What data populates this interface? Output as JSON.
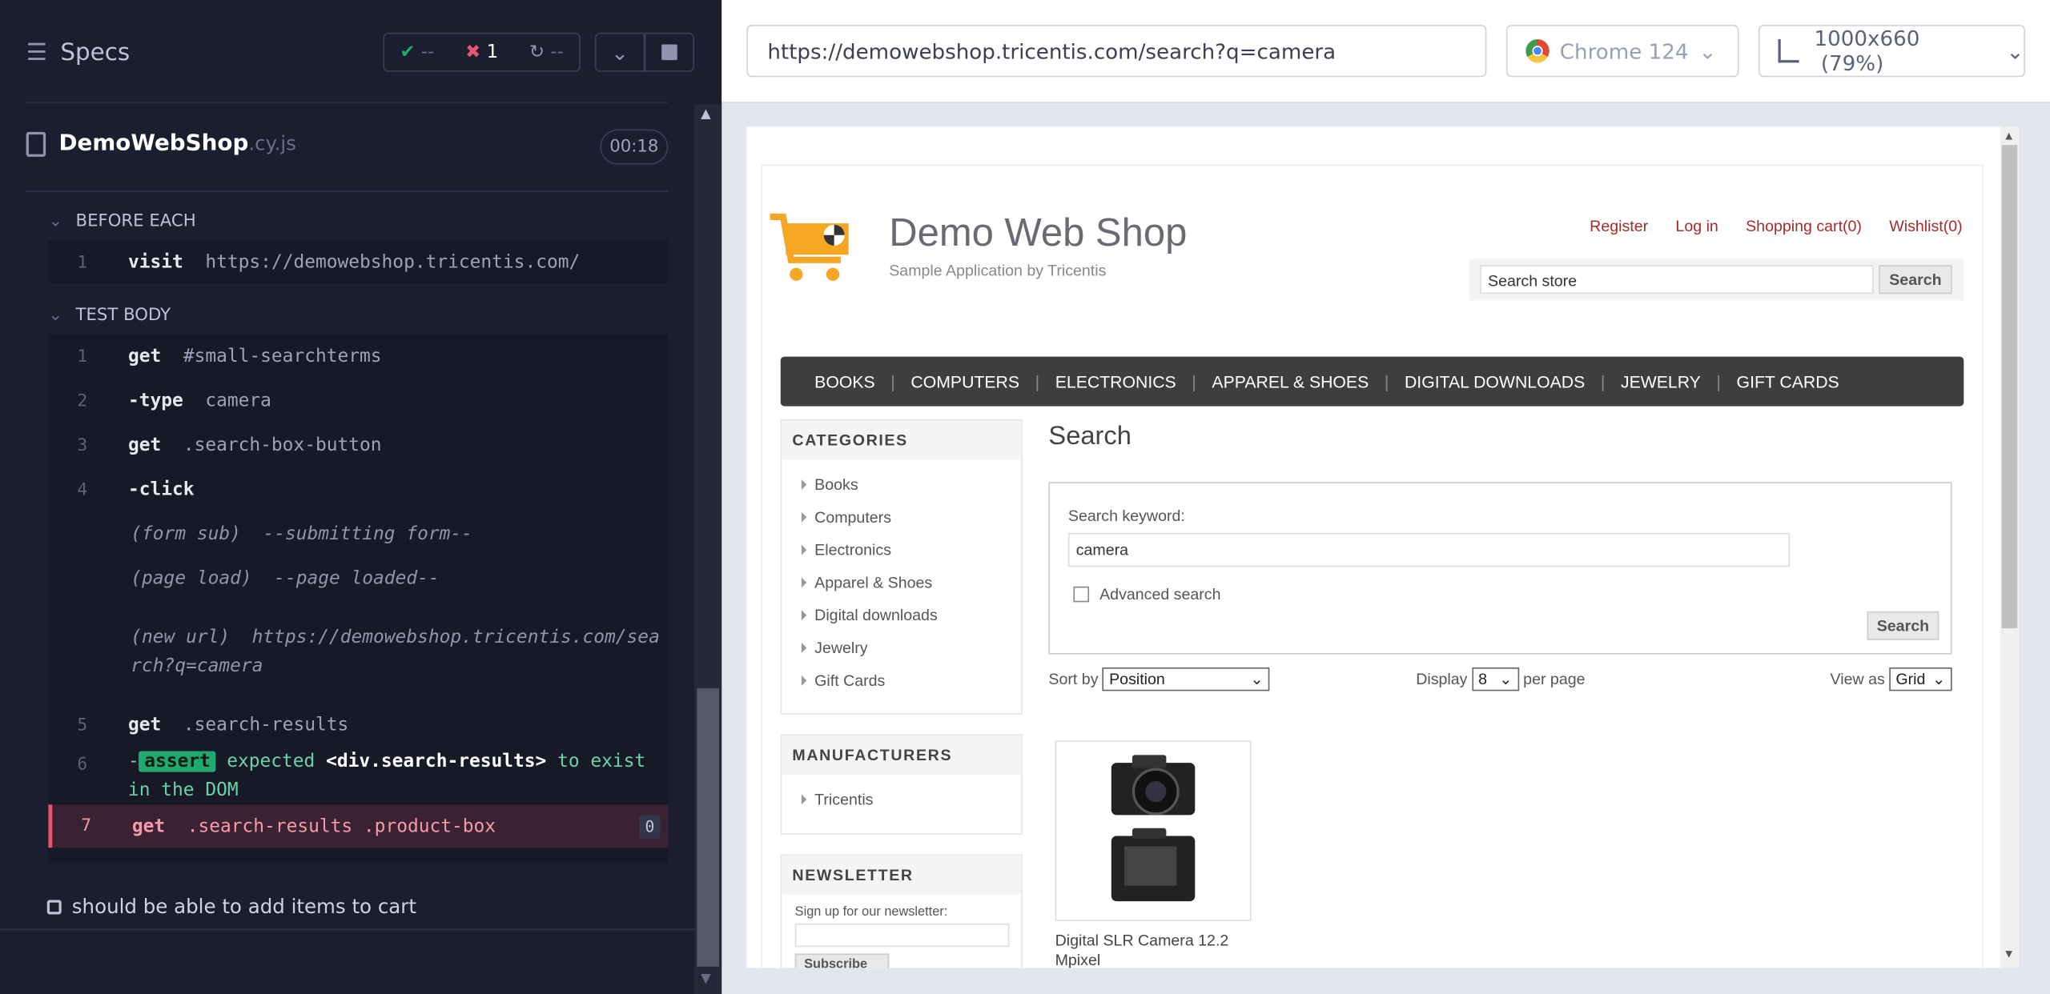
{
  "runner": {
    "specs_label": "Specs",
    "passed": "--",
    "failed": "1",
    "pending": "--",
    "spec_name": "DemoWebShop",
    "spec_ext": ".cy.js",
    "timer": "00:18",
    "before_each": "BEFORE EACH",
    "test_body": "TEST BODY",
    "before_cmd": {
      "num": "1",
      "name": "visit",
      "arg": "https://demowebshop.tricentis.com/"
    },
    "commands": [
      {
        "num": "1",
        "name": "get",
        "arg": "#small-searchterms"
      },
      {
        "num": "2",
        "name": "-type",
        "arg": "camera"
      },
      {
        "num": "3",
        "name": "get",
        "arg": ".search-box-button"
      },
      {
        "num": "4",
        "name": "-click",
        "arg": ""
      }
    ],
    "events": [
      {
        "label": "(form sub)",
        "msg": "--submitting form--"
      },
      {
        "label": "(page load)",
        "msg": "--page loaded--"
      },
      {
        "label": "(new url)",
        "msg": "https://demowebshop.tricentis.com/search?q=camera"
      }
    ],
    "cmd5": {
      "num": "5",
      "name": "get",
      "arg": ".search-results"
    },
    "cmd6": {
      "num": "6",
      "prefix": "-",
      "tag": "assert",
      "msg1": "expected",
      "msg2": "<div.search-results>",
      "msg3": "to",
      "msg4": "exist in the DOM"
    },
    "cmd7": {
      "num": "7",
      "name": "get",
      "arg": ".search-results .product-box",
      "count": "0"
    },
    "next_test": "should be able to add items to cart"
  },
  "aut": {
    "url": "https://demowebshop.tricentis.com/search?q=camera",
    "browser": "Chrome 124",
    "viewport": "1000x660",
    "zoom": "(79%)"
  },
  "site": {
    "logo_title": "Demo Web Shop",
    "logo_sub": "Sample Application by Tricentis",
    "header_links": [
      "Register",
      "Log in",
      "Shopping cart(0)",
      "Wishlist(0)"
    ],
    "search_placeholder": "Search store",
    "search_btn": "Search",
    "menu": [
      "BOOKS",
      "COMPUTERS",
      "ELECTRONICS",
      "APPAREL & SHOES",
      "DIGITAL DOWNLOADS",
      "JEWELRY",
      "GIFT CARDS"
    ],
    "categories_title": "CATEGORIES",
    "categories": [
      "Books",
      "Computers",
      "Electronics",
      "Apparel & Shoes",
      "Digital downloads",
      "Jewelry",
      "Gift Cards"
    ],
    "manufacturers_title": "MANUFACTURERS",
    "manufacturers": [
      "Tricentis"
    ],
    "newsletter_title": "NEWSLETTER",
    "newsletter_text": "Sign up for our newsletter:",
    "subscribe": "Subscribe",
    "page_title": "Search",
    "keyword_label": "Search keyword:",
    "keyword_value": "camera",
    "advanced": "Advanced search",
    "search_button": "Search",
    "sort_label": "Sort by",
    "sort_value": "Position",
    "display_label": "Display",
    "display_value": "8",
    "per_page": "per page",
    "view_label": "View as",
    "view_value": "Grid",
    "product_title": "Digital SLR Camera 12.2 Mpixel"
  }
}
